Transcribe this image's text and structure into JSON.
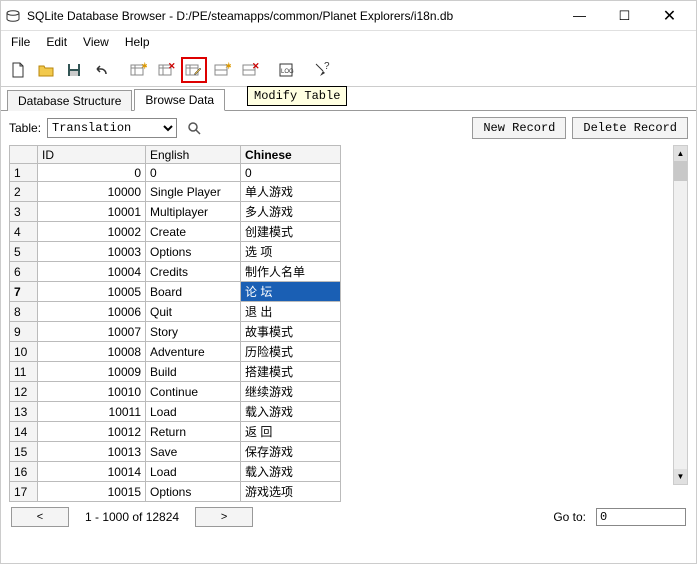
{
  "window": {
    "title": "SQLite Database Browser - D:/PE/steamapps/common/Planet Explorers/i18n.db",
    "min": "—",
    "max": "☐",
    "close": "✕"
  },
  "menu": {
    "items": [
      "File",
      "Edit",
      "View",
      "Help"
    ]
  },
  "tooltip": "Modify Table",
  "tabs": {
    "structure": "Database Structure",
    "browse": "Browse Data"
  },
  "controls": {
    "tableLabel": "Table:",
    "tableValue": "Translation",
    "newRecord": "New Record",
    "deleteRecord": "Delete Record"
  },
  "grid": {
    "headers": {
      "row": "",
      "id": "ID",
      "english": "English",
      "chinese": "Chinese"
    },
    "rows": [
      {
        "n": "1",
        "id": "0",
        "en": "0",
        "cn": "0"
      },
      {
        "n": "2",
        "id": "10000",
        "en": "Single Player",
        "cn": "单人游戏"
      },
      {
        "n": "3",
        "id": "10001",
        "en": "Multiplayer",
        "cn": "多人游戏"
      },
      {
        "n": "4",
        "id": "10002",
        "en": "Create",
        "cn": "创建模式"
      },
      {
        "n": "5",
        "id": "10003",
        "en": "Options",
        "cn": "选 项"
      },
      {
        "n": "6",
        "id": "10004",
        "en": "Credits",
        "cn": "制作人名单"
      },
      {
        "n": "7",
        "id": "10005",
        "en": "Board",
        "cn": "论 坛"
      },
      {
        "n": "8",
        "id": "10006",
        "en": "Quit",
        "cn": "退 出"
      },
      {
        "n": "9",
        "id": "10007",
        "en": "Story",
        "cn": "故事模式"
      },
      {
        "n": "10",
        "id": "10008",
        "en": "Adventure",
        "cn": "历险模式"
      },
      {
        "n": "11",
        "id": "10009",
        "en": "Build",
        "cn": "搭建模式"
      },
      {
        "n": "12",
        "id": "10010",
        "en": "Continue",
        "cn": "继续游戏"
      },
      {
        "n": "13",
        "id": "10011",
        "en": "Load",
        "cn": "载入游戏"
      },
      {
        "n": "14",
        "id": "10012",
        "en": "Return",
        "cn": "返 回"
      },
      {
        "n": "15",
        "id": "10013",
        "en": "Save",
        "cn": "保存游戏"
      },
      {
        "n": "16",
        "id": "10014",
        "en": "Load",
        "cn": "载入游戏"
      },
      {
        "n": "17",
        "id": "10015",
        "en": "Options",
        "cn": "游戏选项"
      }
    ],
    "selectedRow": 6
  },
  "pager": {
    "prev": "<",
    "next": ">",
    "range": "1 - 1000 of 12824",
    "gotoLabel": "Go to:",
    "gotoValue": "0"
  }
}
